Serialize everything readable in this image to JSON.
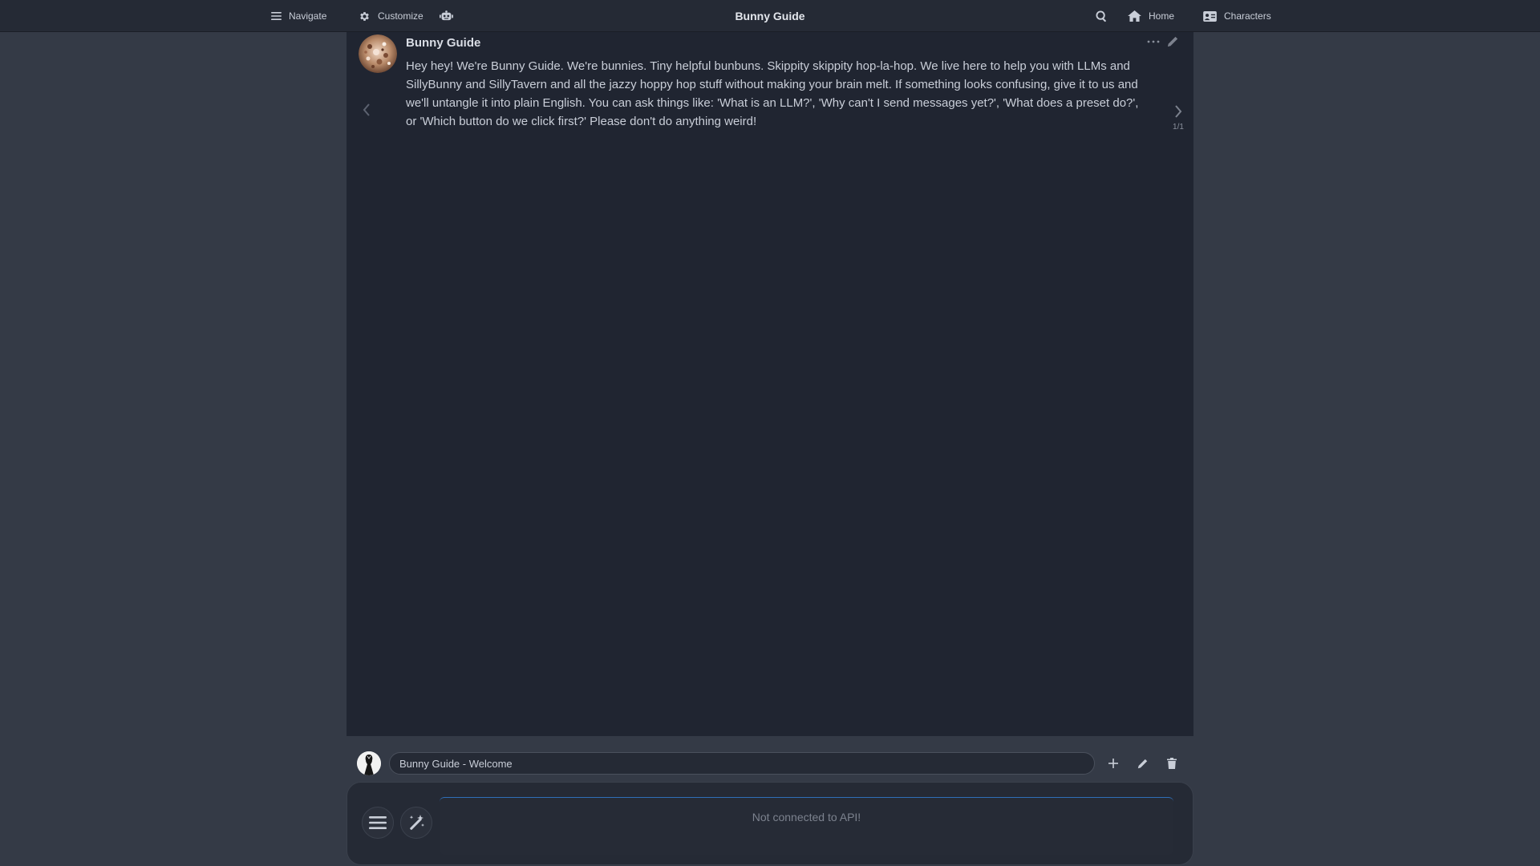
{
  "app": {
    "title": "Bunny Guide"
  },
  "topbar": {
    "navigate_label": "Navigate",
    "customize_label": "Customize",
    "home_label": "Home",
    "characters_label": "Characters"
  },
  "message": {
    "author": "Bunny Guide",
    "text": "Hey hey! We're Bunny Guide. We're bunnies. Tiny helpful bunbuns. Skippity skippity hop-la-hop. We live here to help you with LLMs and SillyBunny and SillyTavern and all the jazzy hoppy hop stuff without making your brain melt. If something looks confusing, give it to us and we'll untangle it into plain English. You can ask things like: 'What is an LLM?', 'Why can't I send messages yet?', 'What does a preset do?', or 'Which button do we click first?' Please don't do anything weird!",
    "swipe_counter": "1/1"
  },
  "chat_bar": {
    "selected_chat": "Bunny Guide - Welcome"
  },
  "composer": {
    "placeholder": "Not connected to API!"
  },
  "icons": {
    "navigate": "hamburger-icon",
    "customize": "gear-icon",
    "robot": "robot-icon",
    "search": "search-icon",
    "home": "home-icon",
    "characters": "id-card-icon",
    "more": "ellipsis-icon",
    "edit": "pencil-icon",
    "swipe_left": "chevron-left-icon",
    "swipe_right": "chevron-right-icon",
    "add": "plus-icon",
    "delete": "trash-icon",
    "options": "hamburger-icon",
    "magic": "magic-wand-icon"
  },
  "colors": {
    "topbar": "#252a35",
    "background": "#343a46",
    "chat_panel": "#202531",
    "accent": "#2f6fb8"
  }
}
